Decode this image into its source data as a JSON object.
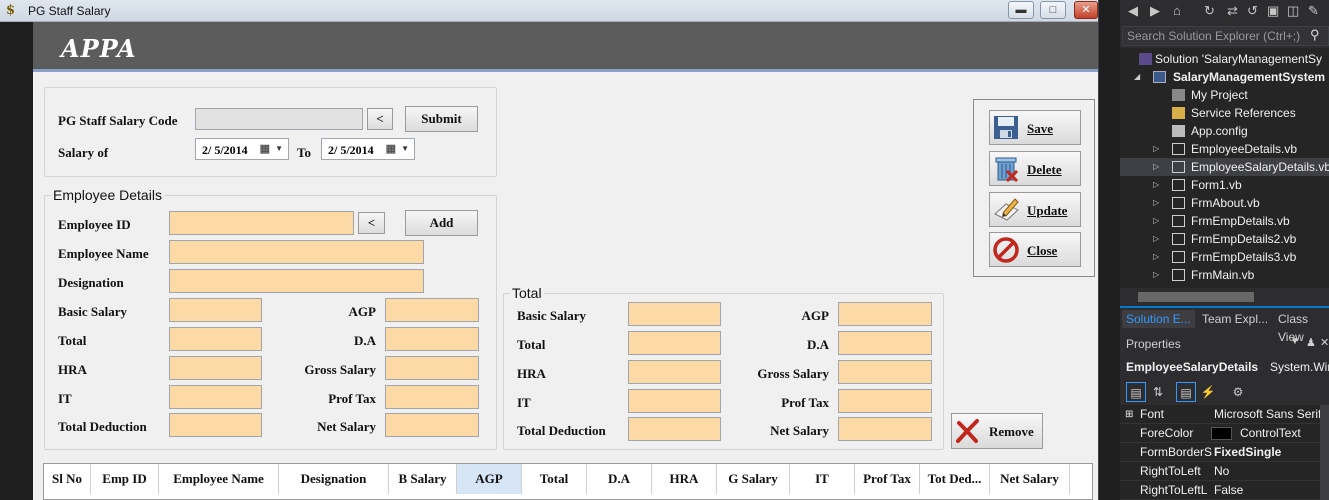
{
  "window": {
    "title": "PG Staff Salary",
    "app_icon": "$"
  },
  "banner": {
    "title": "APPA"
  },
  "top_panel": {
    "code_label": "PG Staff Salary Code",
    "prev_btn": "<",
    "submit_btn": "Submit",
    "salary_of_label": "Salary of",
    "from_date": "2/ 5/2014",
    "to_label": "To",
    "to_date": "2/ 5/2014"
  },
  "employee": {
    "group_title": "Employee Details",
    "id_label": "Employee ID",
    "prev_btn": "<",
    "add_btn": "Add",
    "name_label": "Employee Name",
    "designation_label": "Designation",
    "basic_label": "Basic Salary",
    "agp_label": "AGP",
    "total_label": "Total",
    "da_label": "D.A",
    "hra_label": "HRA",
    "gross_label": "Gross Salary",
    "it_label": "IT",
    "prof_label": "Prof Tax",
    "deduction_label": "Total Deduction",
    "net_label": "Net Salary"
  },
  "total": {
    "group_title": "Total",
    "basic_label": "Basic Salary",
    "agp_label": "AGP",
    "total_label": "Total",
    "da_label": "D.A",
    "hra_label": "HRA",
    "gross_label": "Gross Salary",
    "it_label": "IT",
    "prof_label": "Prof Tax",
    "deduction_label": "Total Deduction",
    "net_label": "Net Salary"
  },
  "actions": {
    "save": "Save",
    "delete": "Delete",
    "update": "Update",
    "close": "Close",
    "remove": "Remove"
  },
  "grid": {
    "columns": [
      "Sl No",
      "Emp ID",
      "Employee Name",
      "Designation",
      "B Salary",
      "AGP",
      "Total",
      "D.A",
      "HRA",
      "G Salary",
      "IT",
      "Prof Tax",
      "Tot Ded...",
      "Net Salary"
    ],
    "selected_column": "AGP"
  },
  "solution_explorer": {
    "search_placeholder": "Search Solution Explorer (Ctrl+;)",
    "items": [
      {
        "label": "Solution 'SalaryManagementSy",
        "level": 0
      },
      {
        "label": "SalaryManagementSystem",
        "level": 1
      },
      {
        "label": "My Project",
        "level": 2
      },
      {
        "label": "Service References",
        "level": 2
      },
      {
        "label": "App.config",
        "level": 2
      },
      {
        "label": "EmployeeDetails.vb",
        "level": 2
      },
      {
        "label": "EmployeeSalaryDetails.vb",
        "level": 2
      },
      {
        "label": "Form1.vb",
        "level": 2
      },
      {
        "label": "FrmAbout.vb",
        "level": 2
      },
      {
        "label": "FrmEmpDetails.vb",
        "level": 2
      },
      {
        "label": "FrmEmpDetails2.vb",
        "level": 2
      },
      {
        "label": "FrmEmpDetails3.vb",
        "level": 2
      },
      {
        "label": "FrmMain.vb",
        "level": 2
      }
    ],
    "tabs": [
      "Solution E...",
      "Team Expl...",
      "Class View"
    ]
  },
  "properties": {
    "header": "Properties",
    "object_name": "EmployeeSalaryDetails",
    "object_type": "System.Win",
    "rows": [
      {
        "name": "Font",
        "value": "Microsoft Sans Serif,"
      },
      {
        "name": "ForeColor",
        "value": "ControlText"
      },
      {
        "name": "FormBorderS",
        "value": "FixedSingle"
      },
      {
        "name": "RightToLeft",
        "value": "No"
      },
      {
        "name": "RightToLeftL",
        "value": "False"
      }
    ]
  },
  "colors": {
    "field_fill": "#fdd9a6",
    "banner": "#5c5c5c",
    "vs_dark": "#2d2d30",
    "accent": "#007acc"
  }
}
